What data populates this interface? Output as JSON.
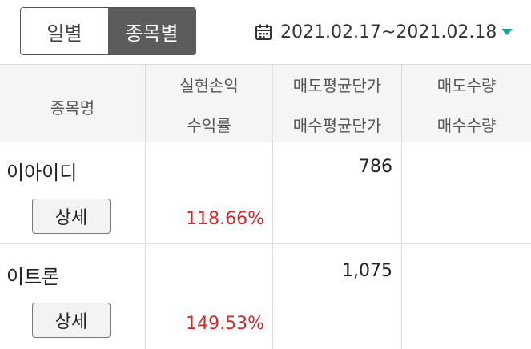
{
  "tabs": [
    {
      "label": "일별",
      "active": false
    },
    {
      "label": "종목별",
      "active": true
    }
  ],
  "date_range": "2021.02.17~2021.02.18",
  "header": {
    "col1": "종목명",
    "col2_top": "실현손익",
    "col2_bottom": "수익률",
    "col3_top": "매도평균단가",
    "col3_bottom": "매수평균단가",
    "col4_top": "매도수량",
    "col4_bottom": "매수수량"
  },
  "rows": [
    {
      "name": "이아이디",
      "detail_label": "상세",
      "realized_pnl": "",
      "return_rate": "118.66%",
      "sell_avg_price": "786",
      "buy_avg_price": "",
      "sell_qty": "",
      "buy_qty": ""
    },
    {
      "name": "이트론",
      "detail_label": "상세",
      "realized_pnl": "",
      "return_rate": "149.53%",
      "sell_avg_price": "1,075",
      "buy_avg_price": "",
      "sell_qty": "",
      "buy_qty": ""
    }
  ],
  "colors": {
    "accent": "#1aa38c",
    "negative_red": "#d12a2a",
    "active_tab_bg": "#5c5c5c"
  }
}
